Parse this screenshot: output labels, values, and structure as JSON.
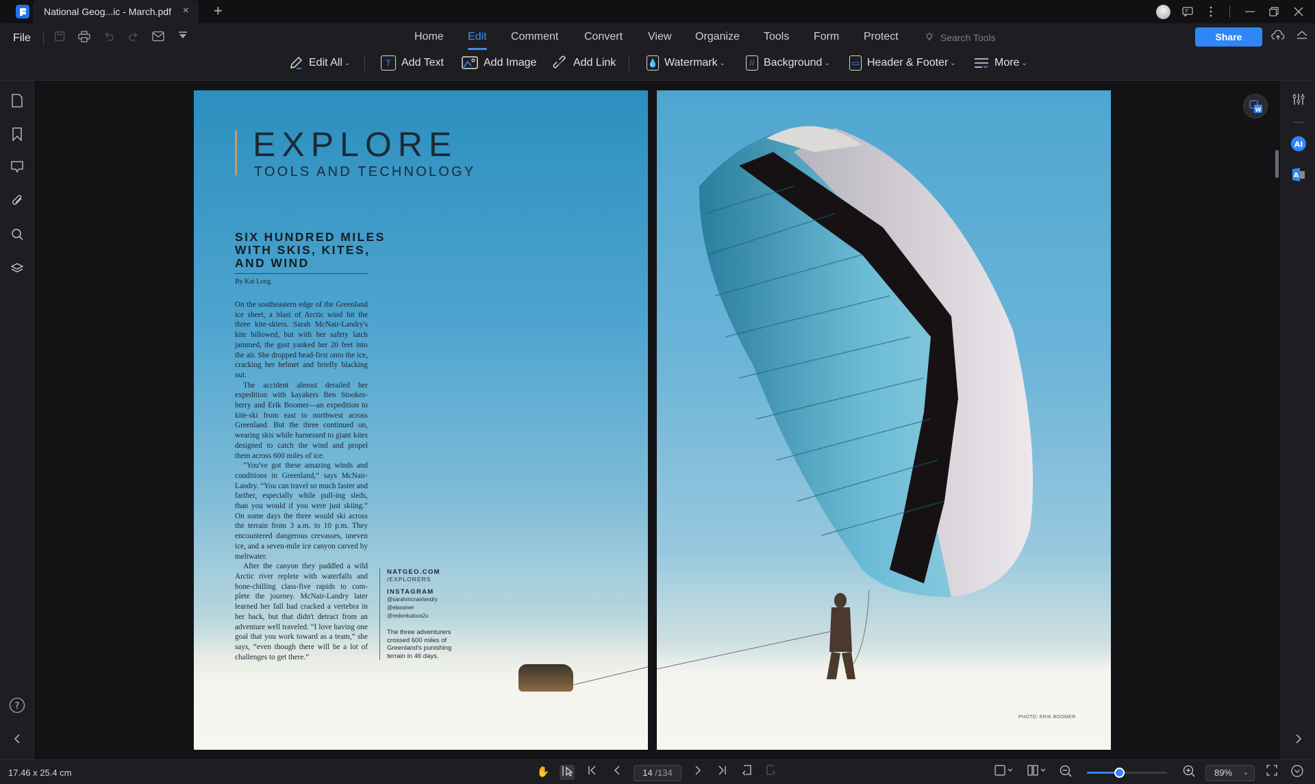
{
  "window": {
    "tab_title": "National  Geog...ic - March.pdf",
    "tab_close": "×",
    "new_tab": "+"
  },
  "menubar": {
    "file_label": "File",
    "nav_tabs": [
      {
        "label": "Home",
        "active": false
      },
      {
        "label": "Edit",
        "active": true
      },
      {
        "label": "Comment",
        "active": false
      },
      {
        "label": "Convert",
        "active": false
      },
      {
        "label": "View",
        "active": false
      },
      {
        "label": "Organize",
        "active": false
      },
      {
        "label": "Tools",
        "active": false
      },
      {
        "label": "Form",
        "active": false
      },
      {
        "label": "Protect",
        "active": false
      }
    ],
    "search_tools_placeholder": "Search Tools",
    "share_label": "Share"
  },
  "toolbar": {
    "edit_all": "Edit All",
    "add_text": "Add Text",
    "add_image": "Add Image",
    "add_link": "Add Link",
    "watermark": "Watermark",
    "background": "Background",
    "header_footer": "Header & Footer",
    "more": "More"
  },
  "document": {
    "section_title": "EXPLORE",
    "section_subtitle": "TOOLS AND TECHNOLOGY",
    "headline": "SIX HUNDRED MILES WITH SKIS, KITES, AND WIND",
    "byline": "By Kat Long",
    "paragraphs": [
      "On the southeastern edge of the Greenland ice sheet, a blast of Arctic wind hit the three kite-skiers. Sarah McNair-Landry's kite billowed, but with her safety latch jammed, the gust yanked her 20 feet into the air. She dropped head-first onto the ice, cracking her helmet and briefly blacking out.",
      "The accident almost derailed her expedition with kayakers Ben Stookes-berry and Erik Boomer—an expedition to kite-ski from east to northwest across Greenland. But the three continued on, wearing skis while harnessed to giant kites designed to catch the wind and propel them across 600 miles of ice.",
      "“You've got these amazing winds and conditions in Greenland,” says McNair-Landry. “You can travel so much faster and farther, especially while pull-ing sleds, than you would if you were just skiing.” On some days the three would ski across the terrain from 3 a.m. to 10 p.m. They encountered dangerous crevasses, uneven ice, and a seven-mile ice canyon carved by meltwater.",
      "After the canyon they paddled a wild Arctic river replete with waterfalls and bone-chilling class-five rapids to com-plete the journey. McNair-Landry later learned her fall had cracked a vertebra in her back, but that didn't detract from an adventure well traveled. “I love having one goal that you work toward as a team,” she says, “even though there will be a lot of challenges to get there.”"
    ],
    "sidebar": {
      "site": "NATGEO.COM",
      "site_path": "/EXPLORERS",
      "instagram_label": "INSTAGRAM",
      "handles": [
        "@sarahmcnairlandry",
        "@eboomer",
        "@redonkulous2u"
      ],
      "caption": "The three adventurers crossed 600 miles of Greenland's punishing terrain in 46 days."
    },
    "photo_credit": "PHOTO: ERIK BOOMER"
  },
  "statusbar": {
    "page_dimensions": "17.46 x 25.4 cm",
    "current_page": "14",
    "total_pages": "/134",
    "zoom_level": "89%",
    "zoom_slider_fraction": 0.4
  },
  "colors": {
    "accent": "#2f86f6",
    "active_tab": "#3d8ef5"
  }
}
